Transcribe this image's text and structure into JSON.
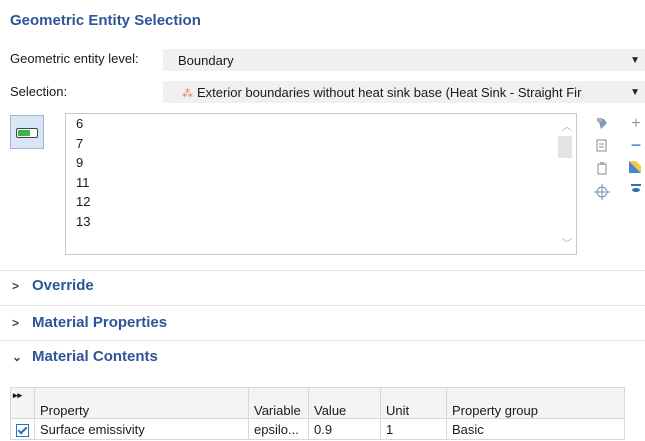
{
  "geometric_entity_selection": {
    "title": "Geometric Entity Selection",
    "level_label": "Geometric entity level:",
    "level_value": "Boundary",
    "selection_label": "Selection:",
    "selection_value": "Exterior boundaries without heat sink base (Heat Sink - Straight Fir",
    "selection_icon": "named-selection-icon",
    "list_items": [
      "6",
      "7",
      "9",
      "11",
      "12",
      "13"
    ],
    "active_toggle_icon": "toggle-active-icon",
    "tools": [
      "paste-selection-icon",
      "add-icon",
      "copy-selection-icon",
      "remove-icon",
      "clear-selection-icon",
      "zoom-selected-icon",
      "locate-icon",
      "show-icon"
    ]
  },
  "sections": {
    "override": "Override",
    "material_properties": "Material Properties",
    "material_contents": "Material Contents"
  },
  "material_table": {
    "expand_icon": "expand-columns-icon",
    "headers": [
      "Property",
      "Variable",
      "Value",
      "Unit",
      "Property group"
    ],
    "rows": [
      {
        "checked": true,
        "property": "Surface emissivity",
        "variable": "epsilo...",
        "value": "0.9",
        "unit": "1",
        "group": "Basic"
      }
    ]
  },
  "colors": {
    "accent": "#2f5597",
    "selection_highlight": "#d8e6f5"
  }
}
